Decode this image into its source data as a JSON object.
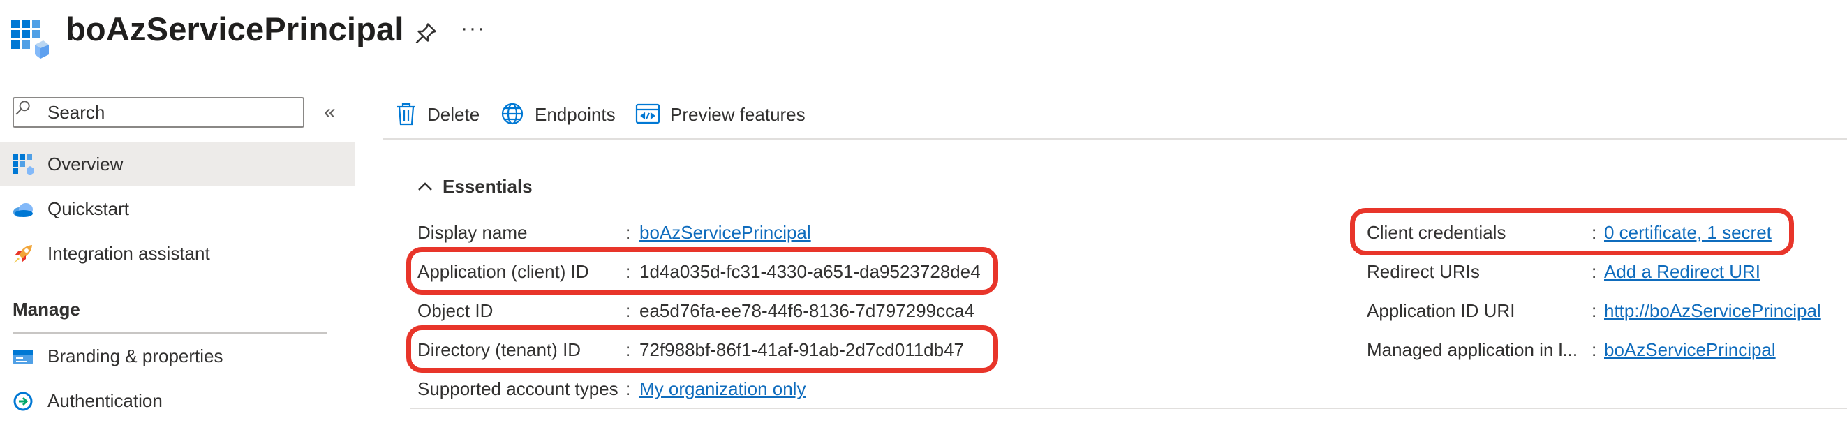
{
  "header": {
    "title": "boAzServicePrincipal",
    "more_label": "···"
  },
  "sidebar": {
    "search_placeholder": "Search",
    "collapse_label": "«",
    "items": [
      {
        "label": "Overview",
        "icon": "grid-icon",
        "selected": true
      },
      {
        "label": "Quickstart",
        "icon": "cloud-icon"
      },
      {
        "label": "Integration assistant",
        "icon": "rocket-icon"
      }
    ],
    "manage_heading": "Manage",
    "manage_items": [
      {
        "label": "Branding & properties",
        "icon": "branding-icon"
      },
      {
        "label": "Authentication",
        "icon": "authentication-icon"
      }
    ]
  },
  "toolbar": {
    "delete_label": "Delete",
    "endpoints_label": "Endpoints",
    "preview_label": "Preview features"
  },
  "essentials": {
    "heading": "Essentials",
    "left": [
      {
        "label": "Display name",
        "value": "boAzServicePrincipal",
        "link": true
      },
      {
        "label": "Application (client) ID",
        "value": "1d4a035d-fc31-4330-a651-da9523728de4",
        "link": false,
        "highlighted": true
      },
      {
        "label": "Object ID",
        "value": "ea5d76fa-ee78-44f6-8136-7d797299cca4",
        "link": false
      },
      {
        "label": "Directory (tenant) ID",
        "value": "72f988bf-86f1-41af-91ab-2d7cd011db47",
        "link": false,
        "highlighted": true
      },
      {
        "label": "Supported account types",
        "value": "My organization only",
        "link": true
      }
    ],
    "right": [
      {
        "label": "Client credentials",
        "value": "0 certificate, 1 secret",
        "link": true,
        "highlighted": true
      },
      {
        "label": "Redirect URIs",
        "value": "Add a Redirect URI",
        "link": true
      },
      {
        "label": "Application ID URI",
        "value": "http://boAzServicePrincipal",
        "link": true
      },
      {
        "label": "Managed application in l...",
        "value": "boAzServicePrincipal",
        "link": true
      }
    ],
    "colon": ":"
  },
  "colors": {
    "highlight": "#e8352a",
    "link": "#0f6cbd",
    "selected_bg": "#edebe9"
  }
}
